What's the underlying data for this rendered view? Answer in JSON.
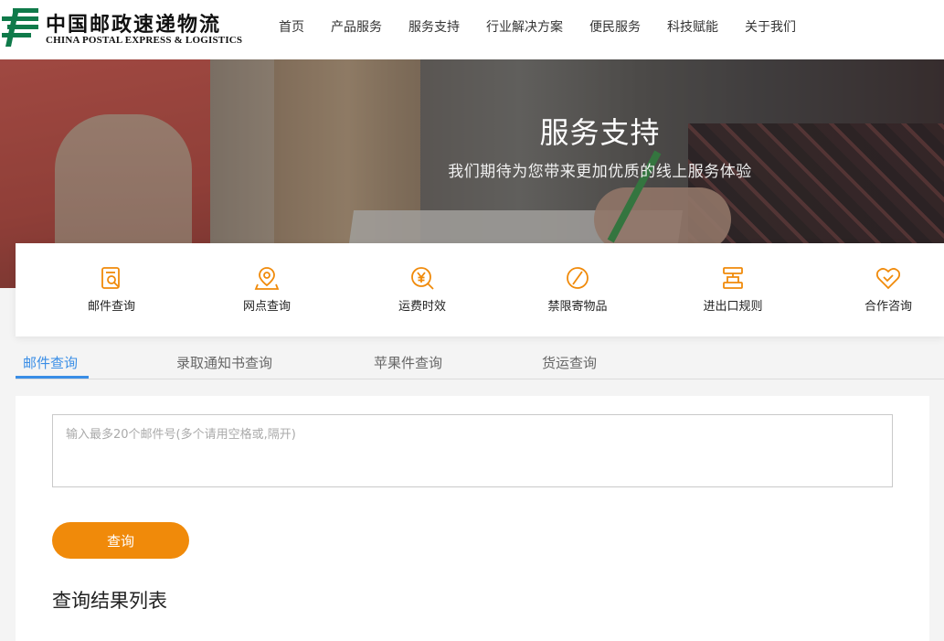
{
  "header": {
    "logo_cn": "中国邮政速递物流",
    "logo_en": "CHINA POSTAL EXPRESS & LOGISTICS",
    "nav": [
      {
        "label": "首页"
      },
      {
        "label": "产品服务"
      },
      {
        "label": "服务支持"
      },
      {
        "label": "行业解决方案"
      },
      {
        "label": "便民服务"
      },
      {
        "label": "科技赋能"
      },
      {
        "label": "关于我们"
      }
    ]
  },
  "banner": {
    "title": "服务支持",
    "subtitle": "我们期待为您带来更加优质的线上服务体验"
  },
  "services": [
    {
      "label": "邮件查询",
      "icon": "mail-search-icon"
    },
    {
      "label": "网点查询",
      "icon": "location-pin-icon"
    },
    {
      "label": "运费时效",
      "icon": "yuan-search-icon"
    },
    {
      "label": "禁限寄物品",
      "icon": "prohibited-icon"
    },
    {
      "label": "进出口规则",
      "icon": "customs-rules-icon"
    },
    {
      "label": "合作咨询",
      "icon": "handshake-heart-icon"
    }
  ],
  "tabs": [
    {
      "label": "邮件查询",
      "active": true
    },
    {
      "label": "录取通知书查询",
      "active": false
    },
    {
      "label": "苹果件查询",
      "active": false
    },
    {
      "label": "货运查询",
      "active": false
    }
  ],
  "query": {
    "placeholder": "输入最多20个邮件号(多个请用空格或,隔开)",
    "value": "",
    "button_label": "查询"
  },
  "results": {
    "title": "查询结果列表"
  },
  "colors": {
    "accent_orange": "#f08a0a",
    "tab_active_blue": "#3a8ee6",
    "logo_green": "#0f7a4a"
  }
}
